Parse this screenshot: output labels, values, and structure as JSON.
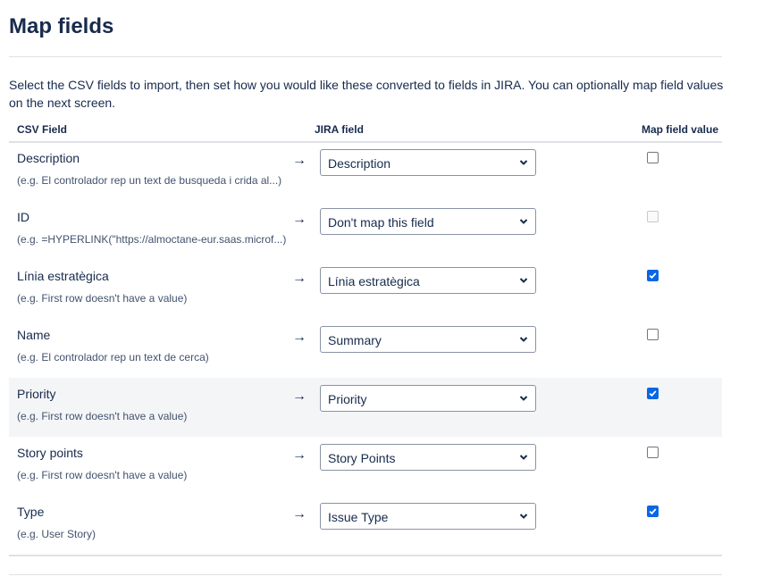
{
  "page": {
    "title": "Map fields",
    "intro": "Select the CSV fields to import, then set how you would like these converted to fields in JIRA. You can optionally map field values on the next screen."
  },
  "table": {
    "headers": {
      "csv_field": "CSV Field",
      "jira_field": "JIRA field",
      "map_value": "Map field value"
    },
    "arrow": "→",
    "rows": [
      {
        "csv_field": "Description",
        "example": "(e.g.  El controlador rep un text de busqueda i crida al...)",
        "jira_field": "Description",
        "map_value": "unchecked",
        "highlighted": false
      },
      {
        "csv_field": "ID",
        "example": "(e.g.  =HYPERLINK(\"https://almoctane-eur.saas.microf...)",
        "jira_field": "Don't map this field",
        "map_value": "disabled",
        "highlighted": false
      },
      {
        "csv_field": "Línia estratègica",
        "example": "(e.g.  First row doesn't have a value)",
        "jira_field": "Línia estratègica",
        "map_value": "checked",
        "highlighted": false
      },
      {
        "csv_field": "Name",
        "example": "(e.g.  El controlador rep un text de cerca)",
        "jira_field": "Summary",
        "map_value": "unchecked",
        "highlighted": false
      },
      {
        "csv_field": "Priority",
        "example": "(e.g.  First row doesn't have a value)",
        "jira_field": "Priority",
        "map_value": "checked",
        "highlighted": true
      },
      {
        "csv_field": "Story points",
        "example": "(e.g.  First row doesn't have a value)",
        "jira_field": "Story Points",
        "map_value": "unchecked",
        "highlighted": false
      },
      {
        "csv_field": "Type",
        "example": "(e.g.  User Story)",
        "jira_field": "Issue Type",
        "map_value": "checked",
        "highlighted": false
      }
    ]
  },
  "colors": {
    "accent": "#0b66e4",
    "text": "#172b4d",
    "muted": "#42526e",
    "row_highlight": "#f4f5f7"
  },
  "icons": {
    "dropdown": "chevron-down-icon",
    "checkbox_check": "check-icon"
  }
}
